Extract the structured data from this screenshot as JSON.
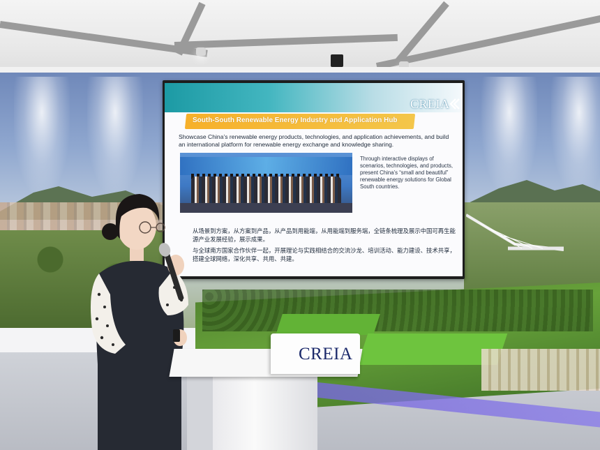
{
  "slide": {
    "logo": "CREIA",
    "title": "South-South Renewable Energy Industry and Application Hub",
    "lead": "Showcase China’s renewable energy products, technologies, and application achievements, and build an international platform for renewable energy exchange and knowledge sharing.",
    "side_text": "Through interactive displays of scenarios, technologies, and products, present China’s “small and beautiful” renewable energy solutions for Global South countries.",
    "cn_paragraph_1": "从场景到方案，从方案到产品，从产品到用能端，从用能端到服务端，全链条梳理及展示中国可再生能源产业发展经验，展示成果。",
    "cn_paragraph_2": "与全球南方国家合作伙伴一起，开展理论与实践相结合的交流沙龙、培训活动、能力建设、技术共享，搭建全球网络，深化共享、共用、共建。"
  },
  "podium": {
    "logo": "CREIA"
  },
  "colors": {
    "slide_header": "#1c9aa4",
    "title_bar": "#f6b02a",
    "podium_logo": "#1c2a6b",
    "model_lawn": "#6ec43e"
  }
}
